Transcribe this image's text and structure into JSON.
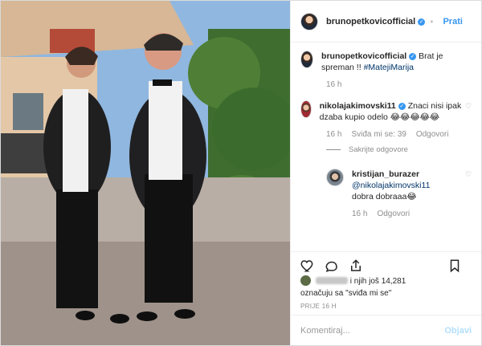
{
  "post": {
    "username": "brunopetkovicofficial",
    "follow_label": "Prati",
    "caption_text": "Brat je spreman !!",
    "caption_tag": "#MatejiMarija",
    "caption_time": "16 h"
  },
  "comments": [
    {
      "username": "nikolajakimovski11",
      "text": "Znaci nisi ipak dzaba kupio odelo 😂😂😂😂😂",
      "time": "16 h",
      "likes": "Sviđa mi se: 39",
      "reply_label": "Odgovori",
      "hide_replies": "Sakrijte odgovore"
    },
    {
      "username": "kristijan_burazer",
      "mention": "@nikolajakimovski11",
      "text": "dobra dobraaa😂",
      "time": "16 h",
      "reply_label": "Odgovori"
    }
  ],
  "likes_text": "i njih još 14,281",
  "likes_text2": "označuju sa \"sviđa mi se\"",
  "post_time": "PRIJE 16 H",
  "comment_placeholder": "Komentiraj...",
  "post_label": "Objavi",
  "colors": {
    "accent": "#3897f0",
    "muted": "#8e8e8e"
  }
}
